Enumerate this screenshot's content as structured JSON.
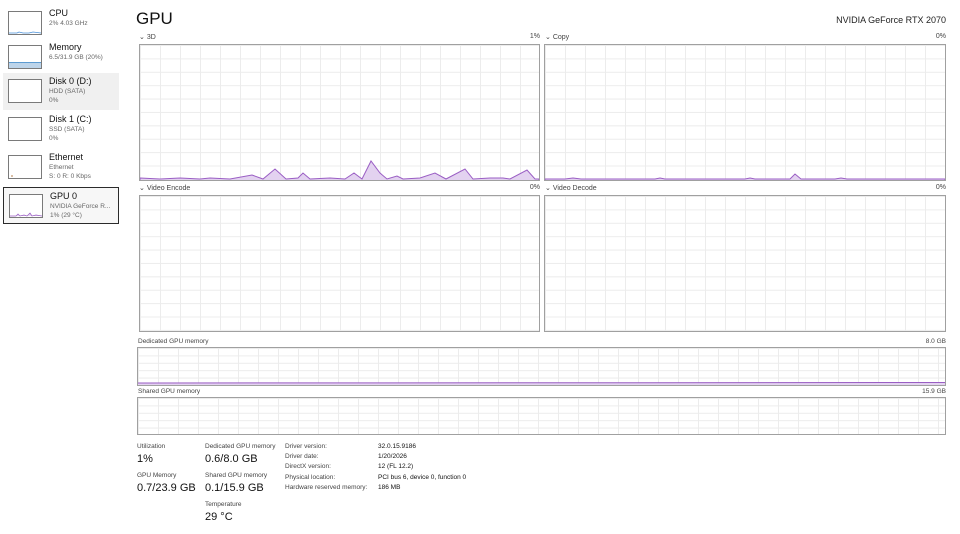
{
  "sidebar": {
    "items": [
      {
        "title": "CPU",
        "sub1": "2% 4.03 GHz",
        "sub2": ""
      },
      {
        "title": "Memory",
        "sub1": "6.5/31.9 GB (20%)",
        "sub2": ""
      },
      {
        "title": "Disk 0 (D:)",
        "sub1": "HDD (SATA)",
        "sub2": "0%"
      },
      {
        "title": "Disk 1 (C:)",
        "sub1": "SSD (SATA)",
        "sub2": "0%"
      },
      {
        "title": "Ethernet",
        "sub1": "Ethernet",
        "sub2": "S: 0 R: 0 Kbps"
      },
      {
        "title": "GPU 0",
        "sub1": "NVIDIA GeForce R...",
        "sub2": "1% (29 °C)"
      }
    ]
  },
  "header": {
    "title": "GPU",
    "model": "NVIDIA GeForce RTX 2070"
  },
  "engines": [
    {
      "name": "3D",
      "percent": "1%"
    },
    {
      "name": "Copy",
      "percent": "0%"
    },
    {
      "name": "Video Encode",
      "percent": "0%"
    },
    {
      "name": "Video Decode",
      "percent": "0%"
    }
  ],
  "memory_graphs": {
    "dedicated": {
      "label": "Dedicated GPU memory",
      "max": "8.0 GB"
    },
    "shared": {
      "label": "Shared GPU memory",
      "max": "15.9 GB"
    }
  },
  "stats": {
    "utilization": {
      "label": "Utilization",
      "value": "1%"
    },
    "dedicated": {
      "label": "Dedicated GPU memory",
      "value": "0.6/8.0 GB"
    },
    "gpu_memory": {
      "label": "GPU Memory",
      "value": "0.7/23.9 GB"
    },
    "shared": {
      "label": "Shared GPU memory",
      "value": "0.1/15.9 GB"
    },
    "temperature": {
      "label": "Temperature",
      "value": "29 °C"
    }
  },
  "info": [
    {
      "key": "Driver version:",
      "value": "32.0.15.9186"
    },
    {
      "key": "Driver date:",
      "value": "1/20/2026"
    },
    {
      "key": "DirectX version:",
      "value": "12 (FL 12.2)"
    },
    {
      "key": "Physical location:",
      "value": "PCI bus 6, device 0, function 0"
    },
    {
      "key": "Hardware reserved memory:",
      "value": "186 MB"
    }
  ],
  "colors": {
    "gpu_line": "#9a5ec4",
    "gpu_fill": "#e3d2f0",
    "grid": "#ececec"
  }
}
